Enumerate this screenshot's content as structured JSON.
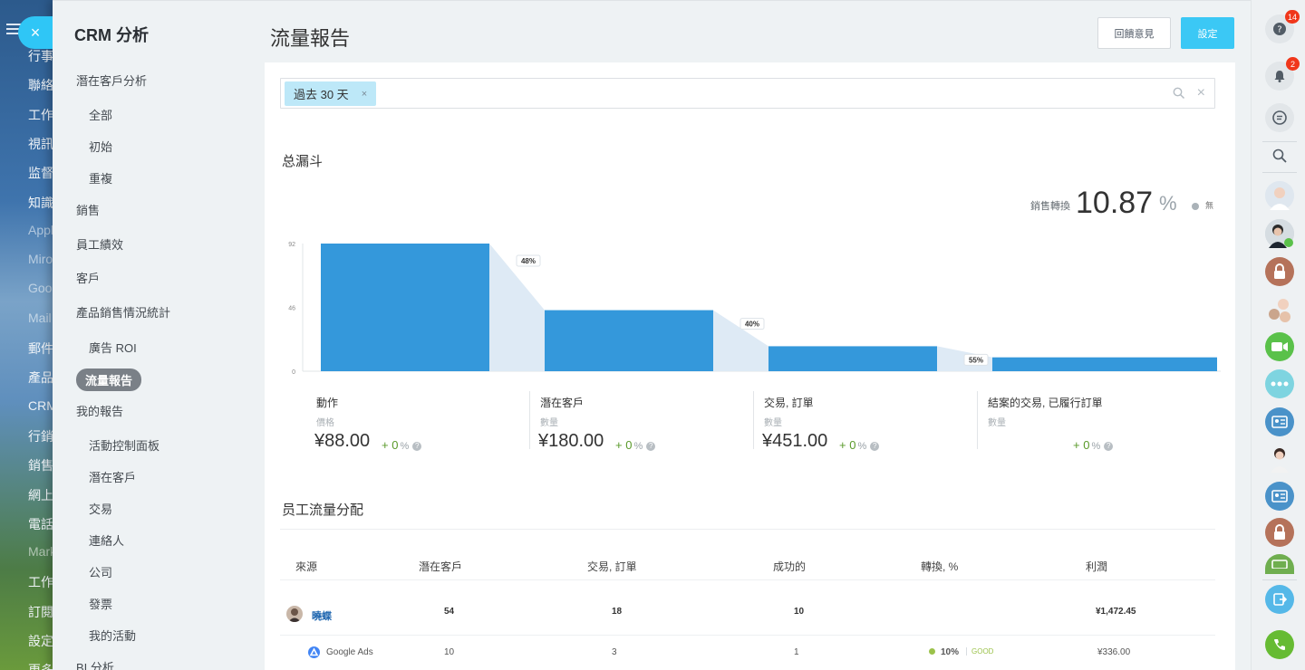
{
  "background_nav": {
    "items": [
      {
        "label": "行事",
        "dim": false
      },
      {
        "label": "聯絡",
        "dim": false
      },
      {
        "label": "工作",
        "dim": false
      },
      {
        "label": "視訊",
        "dim": false
      },
      {
        "label": "监督",
        "dim": false
      },
      {
        "label": "知識",
        "dim": false
      },
      {
        "label": "Appl",
        "dim": true
      },
      {
        "label": "Miro",
        "dim": true
      },
      {
        "label": "Goog",
        "dim": true
      },
      {
        "label": "Mail",
        "dim": true
      },
      {
        "label": "郵件",
        "dim": false
      },
      {
        "label": "產品",
        "dim": false
      },
      {
        "label": "CRM",
        "dim": false
      },
      {
        "label": "行銷",
        "dim": false
      },
      {
        "label": "銷售",
        "dim": false
      },
      {
        "label": "網上",
        "dim": false
      },
      {
        "label": "電話",
        "dim": false
      },
      {
        "label": "Mark",
        "dim": true
      },
      {
        "label": "工作",
        "dim": false
      },
      {
        "label": "訂閱",
        "dim": false
      },
      {
        "label": "設定",
        "dim": false
      },
      {
        "label": "更多",
        "dim": false
      }
    ]
  },
  "close_icon": "×",
  "left_menu": {
    "title": "CRM 分析",
    "items": [
      {
        "label": "潛在客戶分析",
        "level": 1
      },
      {
        "label": "全部",
        "level": 2
      },
      {
        "label": "初始",
        "level": 2
      },
      {
        "label": "重複",
        "level": 2
      },
      {
        "label": "銷售",
        "level": 1
      },
      {
        "label": "員工績效",
        "level": 1
      },
      {
        "label": "客戶",
        "level": 1
      },
      {
        "label": "產品銷售情況統計",
        "level": 1
      },
      {
        "label": "廣告 ROI",
        "level": 2
      },
      {
        "label": "流量報告",
        "level": 1,
        "active": true
      },
      {
        "label": "我的報告",
        "level": 1
      },
      {
        "label": "活動控制面板",
        "level": 2
      },
      {
        "label": "潛在客戶",
        "level": 2
      },
      {
        "label": "交易",
        "level": 2
      },
      {
        "label": "連絡人",
        "level": 2
      },
      {
        "label": "公司",
        "level": 2
      },
      {
        "label": "發票",
        "level": 2
      },
      {
        "label": "我的活動",
        "level": 2
      },
      {
        "label": "BI 分析",
        "level": 1
      }
    ]
  },
  "header": {
    "title": "流量報告",
    "feedback_label": "回饋意見",
    "settings_label": "設定"
  },
  "filter": {
    "chip_label": "過去 30 天",
    "chip_remove": "×",
    "clear_icon": "×"
  },
  "funnel": {
    "title": "总漏斗",
    "conversion_label": "銷售轉換",
    "conversion_value": "10.87",
    "conversion_unit": "%",
    "conversion_none": "無",
    "stages": [
      {
        "title": "動作",
        "sub": "價格",
        "value": "¥88.00",
        "change": "+ 0",
        "unit": "%"
      },
      {
        "title": "潛在客戶",
        "sub": "數量",
        "value": "¥180.00",
        "change": "+ 0",
        "unit": "%"
      },
      {
        "title": "交易, 訂單",
        "sub": "數量",
        "value": "¥451.00",
        "change": "+ 0",
        "unit": "%"
      },
      {
        "title": "結案的交易, 已履行訂單",
        "sub": "數量",
        "value": "",
        "change": "+ 0",
        "unit": "%"
      }
    ]
  },
  "chart_data": {
    "type": "bar",
    "categories": [
      "動作",
      "潛在客戶",
      "交易, 訂單",
      "結案的交易, 已履行訂單"
    ],
    "values": [
      92,
      44,
      18,
      10
    ],
    "conversion_labels": [
      "48%",
      "40%",
      "55%"
    ],
    "y_ticks": [
      "0",
      "46",
      "92"
    ],
    "ylim": [
      0,
      92
    ],
    "color": "#3498db",
    "connector_color": "#deeaf5"
  },
  "employees": {
    "title": "员工流量分配",
    "columns": [
      "來源",
      "潛在客戶",
      "交易, 訂單",
      "成功的",
      "轉換, %",
      "利潤"
    ],
    "rows": [
      {
        "name": "曉蝶",
        "leads": "54",
        "deals": "18",
        "success": "10",
        "conversion": "",
        "profit": "¥1,472.45"
      },
      {
        "name": "Google Ads",
        "leads": "10",
        "deals": "3",
        "success": "1",
        "conversion": "10%",
        "rating": "GOOD",
        "profit": "¥336.00"
      }
    ]
  },
  "right_bar": {
    "help_badge": "14",
    "bell_badge": "2",
    "icons": [
      "help-icon",
      "bell-icon",
      "chat-icon",
      "search-icon"
    ],
    "colors": {
      "lock": "#b5725a",
      "video": "#5ac14a",
      "openline": "#7ed4e0",
      "crm": "#4a92c9",
      "phone": "#66bb33",
      "badge": "#f0371b"
    }
  }
}
